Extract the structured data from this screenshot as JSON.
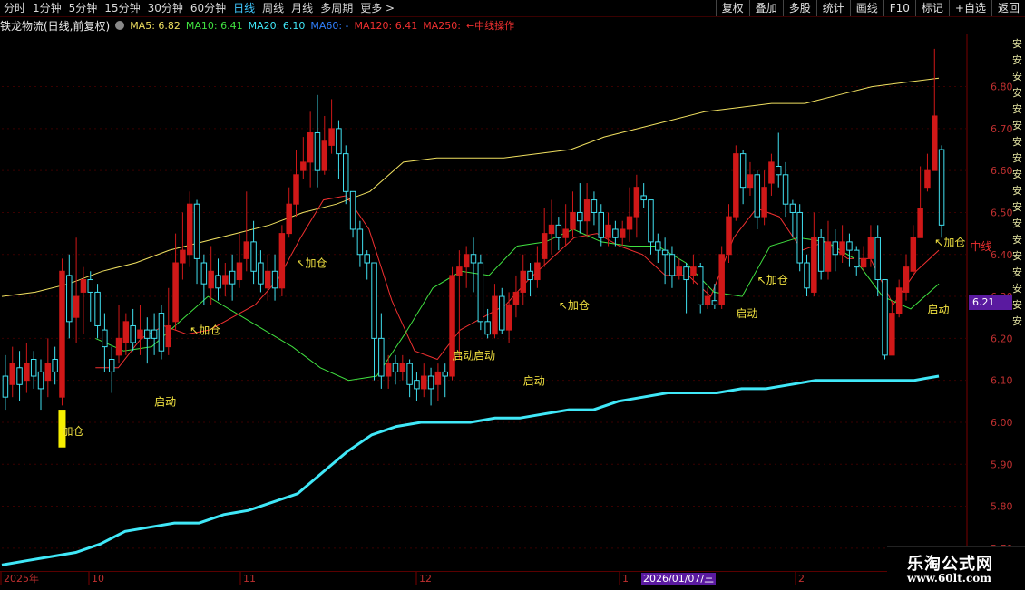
{
  "tabs": [
    {
      "label": "分时",
      "active": false
    },
    {
      "label": "1分钟",
      "active": false
    },
    {
      "label": "5分钟",
      "active": false
    },
    {
      "label": "15分钟",
      "active": false
    },
    {
      "label": "30分钟",
      "active": false
    },
    {
      "label": "60分钟",
      "active": false
    },
    {
      "label": "日线",
      "active": true
    },
    {
      "label": "周线",
      "active": false
    },
    {
      "label": "月线",
      "active": false
    },
    {
      "label": "多周期",
      "active": false
    },
    {
      "label": "更多 >",
      "active": false
    }
  ],
  "tools": [
    "复权",
    "叠加",
    "多股",
    "统计",
    "画线",
    "F10",
    "标记",
    "+自选",
    "返回"
  ],
  "info": {
    "stock": "铁龙物流(日线,前复权)",
    "ma5": "MA5: 6.82",
    "ma10": "MA10: 6.41",
    "ma20": "MA20: 6.10",
    "ma60": "MA60: -",
    "ma120": "MA120: 6.41",
    "ma250": "MA250:",
    "note": "←中线操作"
  },
  "colors": {
    "up": "#d01818",
    "down": "#40e0f0",
    "ma5": "#f0e060",
    "ma10": "#f03030",
    "ma20": "#40e040",
    "ma120": "#40e8f8",
    "label": "#f0e040"
  },
  "price_tag": "6.21",
  "side_chars": [
    "安",
    "安",
    "安",
    "安",
    "安",
    "安",
    "安",
    "安",
    "安",
    "安",
    "安",
    "安",
    "安",
    "安",
    "安",
    "安",
    "安",
    "安"
  ],
  "watermark": {
    "name": "乐淘公式网",
    "url": "www.60lt.com"
  },
  "timeline": {
    "labels": [
      "2025年",
      "10",
      "11",
      "12",
      "1",
      "2"
    ],
    "cursor_date": "2026/01/07/三"
  },
  "chart_data": {
    "type": "candlestick",
    "title": "铁龙物流(日线,前复权)",
    "ylim": [
      5.65,
      6.92
    ],
    "yticks": [
      6.8,
      6.7,
      6.6,
      6.5,
      6.4,
      6.3,
      6.2,
      6.1,
      6.0,
      5.9,
      5.8,
      5.7
    ],
    "candles": [
      [
        6.11,
        6.06,
        6.16,
        6.03
      ],
      [
        6.09,
        6.14,
        6.18,
        6.06
      ],
      [
        6.13,
        6.09,
        6.17,
        6.05
      ],
      [
        6.1,
        6.14,
        6.19,
        6.07
      ],
      [
        6.15,
        6.11,
        6.17,
        6.08
      ],
      [
        6.12,
        6.08,
        6.15,
        6.03
      ],
      [
        6.1,
        6.14,
        6.2,
        6.06
      ],
      [
        6.15,
        6.12,
        6.18,
        6.09
      ],
      [
        6.06,
        6.36,
        6.39,
        6.04
      ],
      [
        6.35,
        6.24,
        6.4,
        6.2
      ],
      [
        6.25,
        6.3,
        6.44,
        6.19
      ],
      [
        6.31,
        6.34,
        6.37,
        6.21
      ],
      [
        6.34,
        6.31,
        6.36,
        6.24
      ],
      [
        6.31,
        6.23,
        6.33,
        6.2
      ],
      [
        6.22,
        6.18,
        6.26,
        6.12
      ],
      [
        6.15,
        6.12,
        6.18,
        6.07
      ],
      [
        6.16,
        6.2,
        6.28,
        6.14
      ],
      [
        6.19,
        6.24,
        6.26,
        6.16
      ],
      [
        6.23,
        6.19,
        6.27,
        6.17
      ],
      [
        6.2,
        6.22,
        6.28,
        6.16
      ],
      [
        6.22,
        6.2,
        6.25,
        6.14
      ],
      [
        6.22,
        6.2,
        6.26,
        6.16
      ],
      [
        6.26,
        6.17,
        6.28,
        6.15
      ],
      [
        6.18,
        6.23,
        6.32,
        6.16
      ],
      [
        6.24,
        6.38,
        6.45,
        6.22
      ],
      [
        6.38,
        6.41,
        6.5,
        6.34
      ],
      [
        6.4,
        6.52,
        6.55,
        6.37
      ],
      [
        6.52,
        6.39,
        6.53,
        6.33
      ],
      [
        6.38,
        6.33,
        6.4,
        6.28
      ],
      [
        6.32,
        6.36,
        6.42,
        6.28
      ],
      [
        6.35,
        6.32,
        6.39,
        6.29
      ],
      [
        6.33,
        6.35,
        6.38,
        6.3
      ],
      [
        6.36,
        6.33,
        6.4,
        6.29
      ],
      [
        6.34,
        6.38,
        6.45,
        6.32
      ],
      [
        6.39,
        6.43,
        6.55,
        6.36
      ],
      [
        6.43,
        6.36,
        6.48,
        6.33
      ],
      [
        6.38,
        6.33,
        6.41,
        6.31
      ],
      [
        6.32,
        6.36,
        6.4,
        6.29
      ],
      [
        6.36,
        6.32,
        6.4,
        6.29
      ],
      [
        6.32,
        6.45,
        6.47,
        6.3
      ],
      [
        6.45,
        6.52,
        6.56,
        6.44
      ],
      [
        6.52,
        6.59,
        6.65,
        6.49
      ],
      [
        6.6,
        6.62,
        6.68,
        6.58
      ],
      [
        6.62,
        6.69,
        6.74,
        6.56
      ],
      [
        6.69,
        6.6,
        6.78,
        6.56
      ],
      [
        6.6,
        6.67,
        6.73,
        6.59
      ],
      [
        6.66,
        6.7,
        6.77,
        6.64
      ],
      [
        6.7,
        6.64,
        6.72,
        6.58
      ],
      [
        6.64,
        6.55,
        6.66,
        6.52
      ],
      [
        6.55,
        6.46,
        6.55,
        6.44
      ],
      [
        6.46,
        6.4,
        6.48,
        6.37
      ],
      [
        6.4,
        6.38,
        6.41,
        6.34
      ],
      [
        6.38,
        6.2,
        6.38,
        6.1
      ],
      [
        6.2,
        6.11,
        6.26,
        6.08
      ],
      [
        6.11,
        6.14,
        6.16,
        6.08
      ],
      [
        6.14,
        6.12,
        6.16,
        6.09
      ],
      [
        6.12,
        6.14,
        6.16,
        6.1
      ],
      [
        6.14,
        6.09,
        6.15,
        6.06
      ],
      [
        6.1,
        6.08,
        6.12,
        6.05
      ],
      [
        6.08,
        6.11,
        6.14,
        6.06
      ],
      [
        6.11,
        6.08,
        6.13,
        6.04
      ],
      [
        6.09,
        6.12,
        6.14,
        6.05
      ],
      [
        6.12,
        6.11,
        6.14,
        6.06
      ],
      [
        6.11,
        6.35,
        6.37,
        6.1
      ],
      [
        6.35,
        6.37,
        6.41,
        6.15
      ],
      [
        6.37,
        6.4,
        6.42,
        6.32
      ],
      [
        6.4,
        6.38,
        6.44,
        6.31
      ],
      [
        6.38,
        6.24,
        6.4,
        6.22
      ],
      [
        6.24,
        6.21,
        6.27,
        6.2
      ],
      [
        6.21,
        6.3,
        6.33,
        6.2
      ],
      [
        6.3,
        6.22,
        6.32,
        6.21
      ],
      [
        6.22,
        6.28,
        6.31,
        6.19
      ],
      [
        6.28,
        6.31,
        6.35,
        6.25
      ],
      [
        6.31,
        6.36,
        6.4,
        6.28
      ],
      [
        6.36,
        6.34,
        6.38,
        6.3
      ],
      [
        6.34,
        6.38,
        6.42,
        6.32
      ],
      [
        6.39,
        6.45,
        6.51,
        6.37
      ],
      [
        6.45,
        6.47,
        6.53,
        6.4
      ],
      [
        6.47,
        6.44,
        6.49,
        6.41
      ],
      [
        6.44,
        6.46,
        6.52,
        6.42
      ],
      [
        6.46,
        6.5,
        6.55,
        6.44
      ],
      [
        6.5,
        6.48,
        6.57,
        6.45
      ],
      [
        6.48,
        6.53,
        6.57,
        6.44
      ],
      [
        6.53,
        6.5,
        6.55,
        6.47
      ],
      [
        6.5,
        6.44,
        6.52,
        6.42
      ],
      [
        6.44,
        6.47,
        6.5,
        6.42
      ],
      [
        6.46,
        6.44,
        6.48,
        6.42
      ],
      [
        6.44,
        6.46,
        6.48,
        6.42
      ],
      [
        6.46,
        6.49,
        6.56,
        6.43
      ],
      [
        6.49,
        6.56,
        6.59,
        6.44
      ],
      [
        6.54,
        6.53,
        6.57,
        6.51
      ],
      [
        6.53,
        6.43,
        6.53,
        6.4
      ],
      [
        6.43,
        6.41,
        6.45,
        6.38
      ],
      [
        6.41,
        6.4,
        6.44,
        6.33
      ],
      [
        6.4,
        6.35,
        6.42,
        6.32
      ],
      [
        6.35,
        6.37,
        6.39,
        6.34
      ],
      [
        6.37,
        6.34,
        6.38,
        6.26
      ],
      [
        6.35,
        6.37,
        6.4,
        6.33
      ],
      [
        6.37,
        6.28,
        6.38,
        6.26
      ],
      [
        6.28,
        6.3,
        6.32,
        6.27
      ],
      [
        6.29,
        6.28,
        6.33,
        6.27
      ],
      [
        6.28,
        6.4,
        6.42,
        6.27
      ],
      [
        6.4,
        6.49,
        6.52,
        6.38
      ],
      [
        6.49,
        6.64,
        6.66,
        6.48
      ],
      [
        6.64,
        6.56,
        6.65,
        6.52
      ],
      [
        6.56,
        6.59,
        6.62,
        6.54
      ],
      [
        6.59,
        6.49,
        6.6,
        6.46
      ],
      [
        6.49,
        6.56,
        6.6,
        6.47
      ],
      [
        6.57,
        6.62,
        6.64,
        6.54
      ],
      [
        6.61,
        6.59,
        6.69,
        6.56
      ],
      [
        6.59,
        6.52,
        6.62,
        6.49
      ],
      [
        6.52,
        6.5,
        6.53,
        6.44
      ],
      [
        6.5,
        6.38,
        6.52,
        6.36
      ],
      [
        6.38,
        6.32,
        6.4,
        6.3
      ],
      [
        6.31,
        6.44,
        6.5,
        6.3
      ],
      [
        6.44,
        6.36,
        6.46,
        6.34
      ],
      [
        6.36,
        6.43,
        6.48,
        6.34
      ],
      [
        6.43,
        6.4,
        6.46,
        6.36
      ],
      [
        6.4,
        6.43,
        6.47,
        6.38
      ],
      [
        6.43,
        6.41,
        6.45,
        6.37
      ],
      [
        6.41,
        6.37,
        6.42,
        6.35
      ],
      [
        6.37,
        6.39,
        6.42,
        6.36
      ],
      [
        6.39,
        6.44,
        6.47,
        6.37
      ],
      [
        6.44,
        6.34,
        6.47,
        6.3
      ],
      [
        6.34,
        6.16,
        6.34,
        6.15
      ],
      [
        6.16,
        6.26,
        6.29,
        6.18
      ],
      [
        6.26,
        6.32,
        6.34,
        6.25
      ],
      [
        6.31,
        6.37,
        6.4,
        6.29
      ],
      [
        6.36,
        6.44,
        6.47,
        6.35
      ],
      [
        6.44,
        6.51,
        6.61,
        6.44
      ],
      [
        6.56,
        6.6,
        6.64,
        6.55
      ],
      [
        6.6,
        6.73,
        6.89,
        6.6
      ],
      [
        6.65,
        6.47,
        6.66,
        6.44
      ]
    ],
    "annotations": [
      {
        "text": "加仓",
        "index": 8,
        "price": 5.97,
        "arrow": false
      },
      {
        "text": "启动",
        "index": 21,
        "price": 6.04,
        "arrow": false
      },
      {
        "text": "↖加仓",
        "index": 26,
        "price": 6.21,
        "arrow": true
      },
      {
        "text": "↖加仓",
        "index": 41,
        "price": 6.37,
        "arrow": true
      },
      {
        "text": "启动",
        "index": 63,
        "price": 6.15,
        "arrow": false
      },
      {
        "text": "启动",
        "index": 66,
        "price": 6.15,
        "arrow": false
      },
      {
        "text": "启动",
        "index": 73,
        "price": 6.09,
        "arrow": false
      },
      {
        "text": "↖加仓",
        "index": 78,
        "price": 6.27,
        "arrow": true
      },
      {
        "text": "启动",
        "index": 103,
        "price": 6.25,
        "arrow": false
      },
      {
        "text": "↖加仓",
        "index": 106,
        "price": 6.33,
        "arrow": true
      },
      {
        "text": "启动",
        "index": 130,
        "price": 6.26,
        "arrow": false
      },
      {
        "text": "↖加仓",
        "index": 131,
        "price": 6.42,
        "arrow": true
      },
      {
        "text": "中线",
        "index": 136,
        "price": 6.41,
        "arrow": false
      }
    ],
    "ma5_line": [
      6.3,
      6.31,
      6.33,
      6.36,
      6.38,
      6.41,
      6.43,
      6.45,
      6.47,
      6.5,
      6.52,
      6.55,
      6.62,
      6.63,
      6.63,
      6.63,
      6.64,
      6.65,
      6.68,
      6.7,
      6.72,
      6.74,
      6.75,
      6.76,
      6.76,
      6.78,
      6.8,
      6.81,
      6.82
    ],
    "ma10_line": [
      6.13,
      6.13,
      6.2,
      6.23,
      6.21,
      6.22,
      6.25,
      6.28,
      6.34,
      6.44,
      6.53,
      6.54,
      6.46,
      6.29,
      6.17,
      6.15,
      6.22,
      6.25,
      6.28,
      6.34,
      6.39,
      6.44,
      6.45,
      6.42,
      6.4,
      6.35,
      6.35,
      6.3,
      6.44,
      6.51,
      6.49,
      6.41,
      6.43,
      6.39,
      6.39,
      6.28,
      6.36,
      6.41
    ],
    "ma20_line": [
      6.2,
      6.17,
      6.18,
      6.24,
      6.3,
      6.26,
      6.22,
      6.18,
      6.13,
      6.1,
      6.11,
      6.21,
      6.32,
      6.36,
      6.35,
      6.42,
      6.43,
      6.46,
      6.43,
      6.42,
      6.42,
      6.38,
      6.31,
      6.3,
      6.42,
      6.44,
      6.43,
      6.39,
      6.3,
      6.27,
      6.33
    ],
    "ma120_line": [
      5.66,
      5.67,
      5.68,
      5.69,
      5.71,
      5.74,
      5.75,
      5.76,
      5.76,
      5.78,
      5.79,
      5.81,
      5.83,
      5.88,
      5.93,
      5.97,
      5.99,
      6.0,
      6.0,
      6.0,
      6.01,
      6.01,
      6.02,
      6.03,
      6.03,
      6.05,
      6.06,
      6.07,
      6.07,
      6.07,
      6.08,
      6.08,
      6.09,
      6.1,
      6.1,
      6.1,
      6.1,
      6.1,
      6.11
    ]
  }
}
